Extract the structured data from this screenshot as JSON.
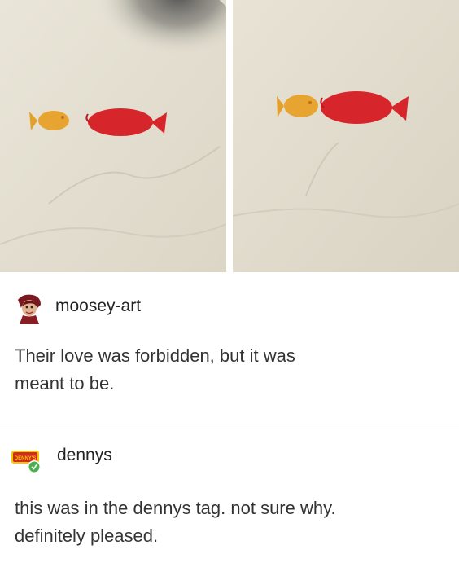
{
  "posts": [
    {
      "username": "moosey-art",
      "avatar_icon": "character-avatar-icon",
      "text_lines": [
        "Their love was forbidden, but it was",
        "meant to be."
      ]
    },
    {
      "username": "dennys",
      "avatar_icon": "dennys-logo-icon",
      "avatar_logo_text": "DENNY'S",
      "text_lines": [
        "this was in the dennys tag. not sure why.",
        "definitely pleased."
      ]
    }
  ],
  "colors": {
    "background": "#ffffff",
    "divider": "#d9d9d9",
    "goldfish_orange": "#e8a430",
    "red_fish": "#d6252b",
    "dennys_red": "#d02a23",
    "dennys_yellow": "#f5c800",
    "badge_green": "#4caf50"
  }
}
